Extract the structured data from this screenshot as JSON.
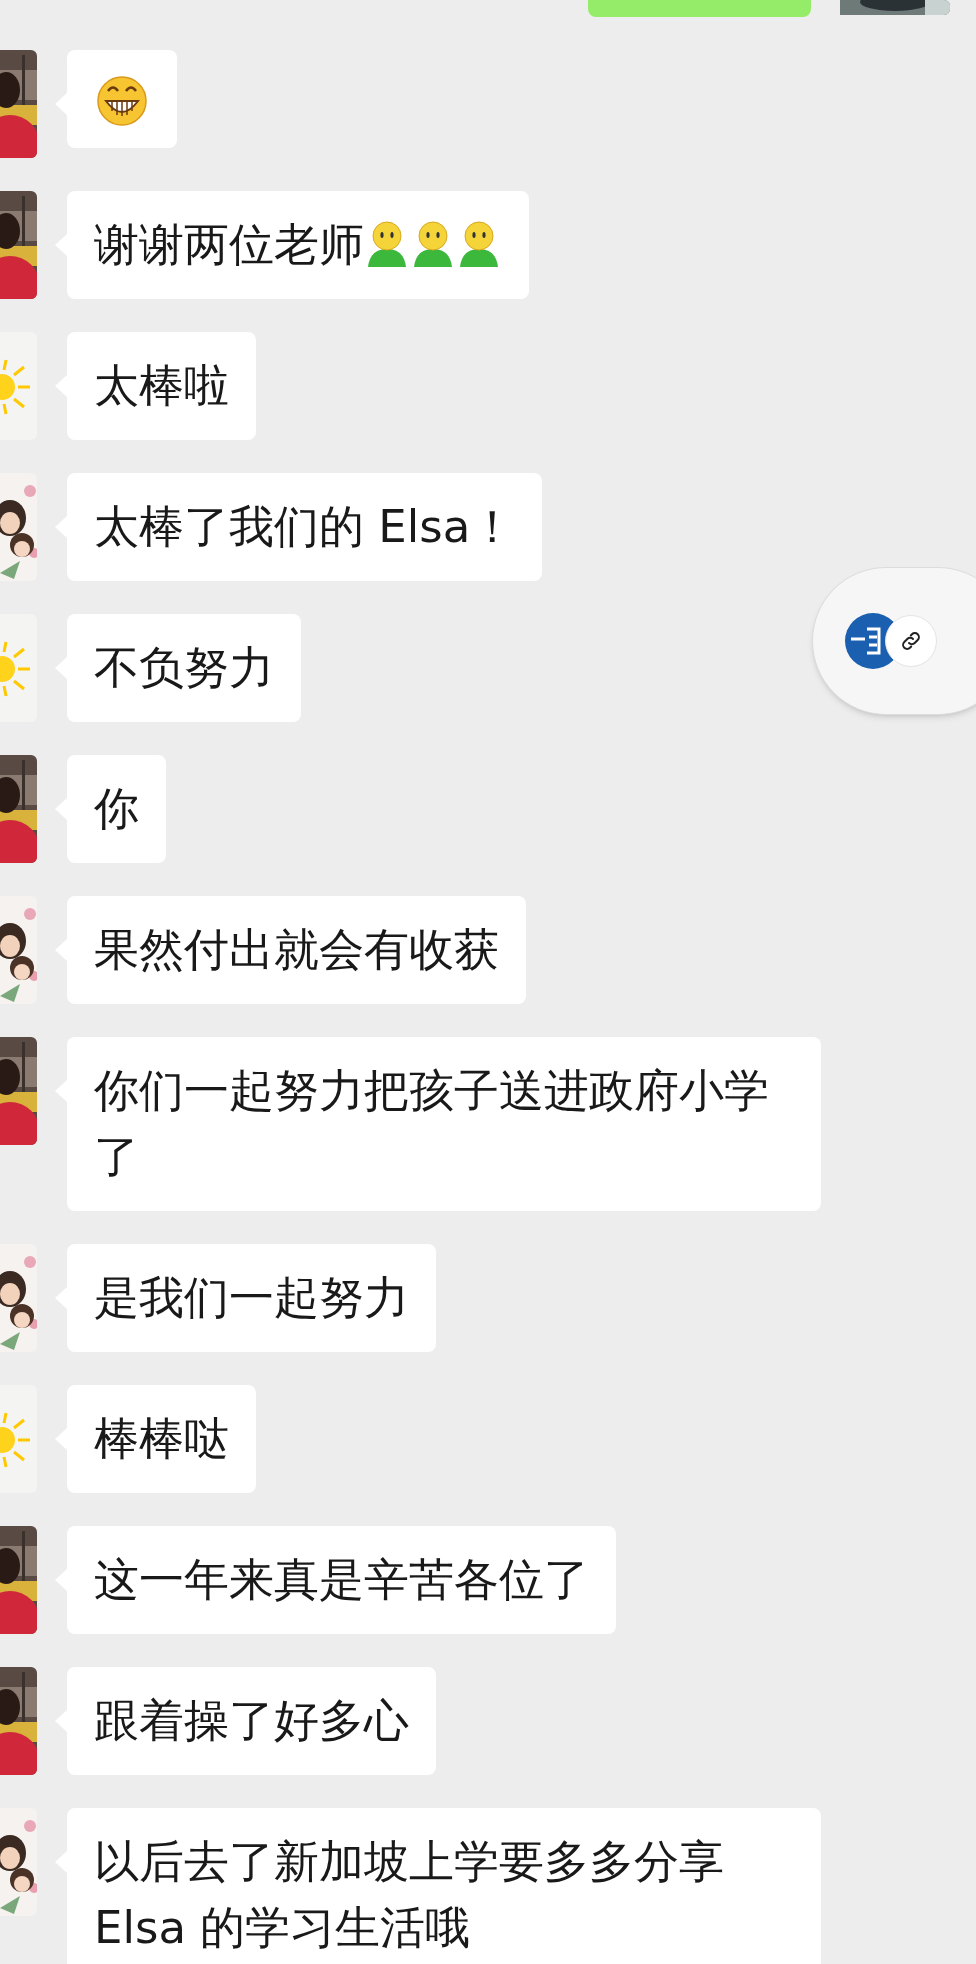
{
  "messages": [
    {
      "kind": "self"
    },
    {
      "kind": "red",
      "parts": [
        {
          "kind": "grin"
        }
      ]
    },
    {
      "kind": "red",
      "parts": [
        {
          "kind": "text",
          "text": "谢谢两位老师"
        },
        {
          "kind": "figure"
        },
        {
          "kind": "figure"
        },
        {
          "kind": "figure"
        }
      ]
    },
    {
      "kind": "sun",
      "parts": [
        {
          "kind": "text",
          "text": "太棒啦"
        }
      ]
    },
    {
      "kind": "flowers",
      "parts": [
        {
          "kind": "text",
          "text": "太棒了我们的 Elsa！"
        }
      ]
    },
    {
      "kind": "sun",
      "parts": [
        {
          "kind": "text",
          "text": "不负努力"
        }
      ]
    },
    {
      "kind": "red",
      "parts": [
        {
          "kind": "text",
          "text": "你"
        }
      ]
    },
    {
      "kind": "flowers",
      "parts": [
        {
          "kind": "text",
          "text": "果然付出就会有收获"
        }
      ]
    },
    {
      "kind": "red",
      "parts": [
        {
          "kind": "text",
          "text": "你们一起努力把孩子送进政府小学了"
        }
      ]
    },
    {
      "kind": "flowers",
      "parts": [
        {
          "kind": "text",
          "text": "是我们一起努力"
        }
      ]
    },
    {
      "kind": "sun",
      "parts": [
        {
          "kind": "text",
          "text": "棒棒哒"
        }
      ]
    },
    {
      "kind": "red",
      "parts": [
        {
          "kind": "text",
          "text": "这一年来真是辛苦各位了"
        }
      ]
    },
    {
      "kind": "red",
      "parts": [
        {
          "kind": "text",
          "text": "跟着操了好多心"
        }
      ]
    },
    {
      "kind": "flowers",
      "parts": [
        {
          "kind": "text",
          "text": "以后去了新加坡上学要多多分享Elsa 的学习生活哦"
        }
      ]
    }
  ]
}
